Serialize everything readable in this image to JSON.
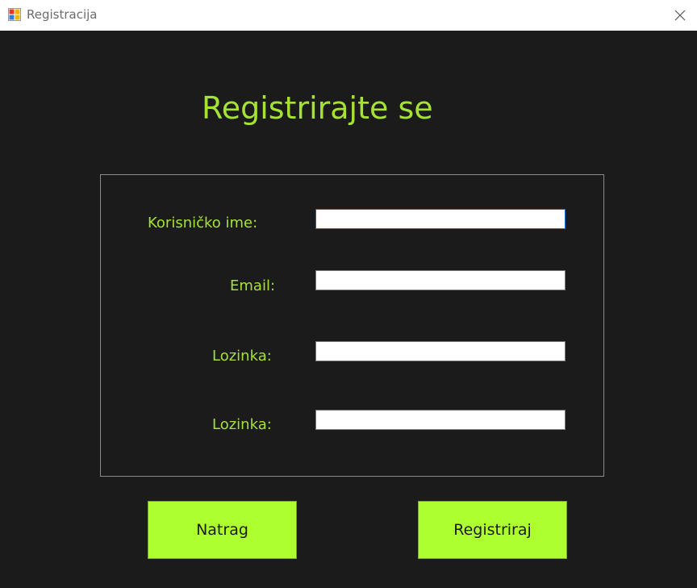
{
  "window": {
    "title": "Registracija",
    "app_icon": "winforms-app-icon",
    "close_icon": "close-icon"
  },
  "form": {
    "heading": "Registrirajte se",
    "fields": [
      {
        "label": "Korisničko ime:",
        "value": "",
        "placeholder": ""
      },
      {
        "label": "Email:",
        "value": "",
        "placeholder": ""
      },
      {
        "label": "Lozinka:",
        "value": "",
        "placeholder": ""
      },
      {
        "label": "Lozinka:",
        "value": "",
        "placeholder": ""
      }
    ]
  },
  "buttons": {
    "back_label": "Natrag",
    "register_label": "Registriraj"
  },
  "colors": {
    "background": "#1b1b1b",
    "accent": "#a6e234",
    "button": "#adff2f"
  }
}
